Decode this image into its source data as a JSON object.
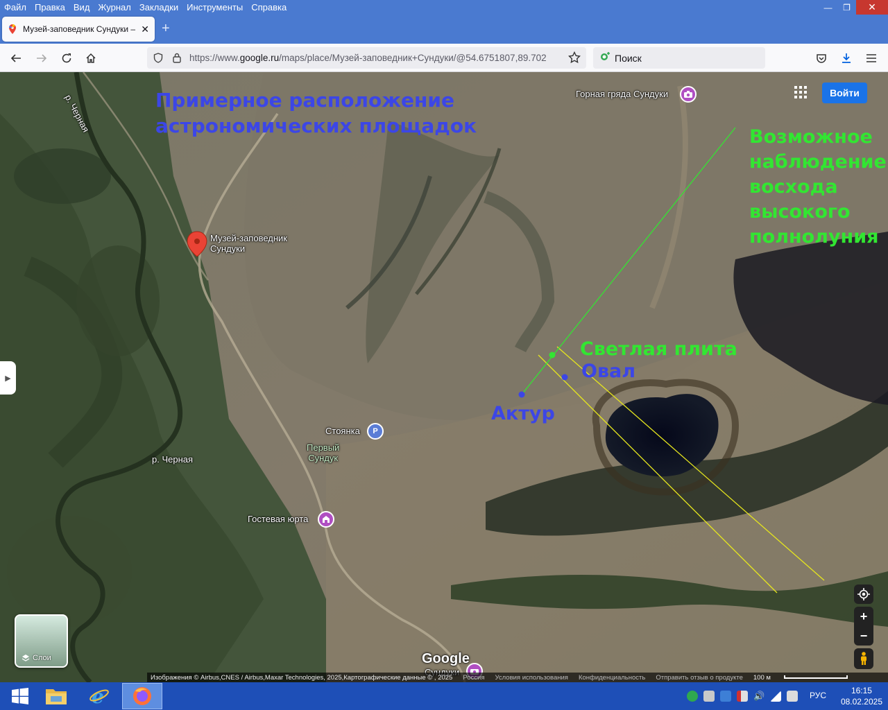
{
  "menu": [
    "Файл",
    "Правка",
    "Вид",
    "Журнал",
    "Закладки",
    "Инструменты",
    "Справка"
  ],
  "tab": {
    "title": "Музей-заповедник Сундуки – G",
    "close": "✕",
    "new_tab": "+"
  },
  "urlbar": {
    "prefix": "https://www.",
    "domain": "google.ru",
    "path": "/maps/place/Музей-заповедник+Сундуки/@54.6751807,89.702"
  },
  "searchbar": {
    "placeholder": "Поиск"
  },
  "map": {
    "title_line1": "Примерное расположение",
    "title_line2": "астрономических площадок",
    "moon_lines": [
      "Возможное",
      "наблюдение",
      "восхода",
      "высокого",
      "полнолуния"
    ],
    "plate_label": "Светлая плита",
    "oval_label": "Овал",
    "aktur_label": "Актур",
    "labels": {
      "ridge": "Горная гряда Сундуки",
      "museum_line1": "Музей-заповедник",
      "museum_line2": "Сундуки",
      "river_top": "р. Черная",
      "river_mid": "р. Черная",
      "parking": "Стоянка",
      "parking_icon": "P",
      "first_sunduk_line1": "Первый",
      "first_sunduk_line2": "Сундук",
      "guest_yurt": "Гостевая юрта",
      "bottom_poi": "Сундуки"
    },
    "signin": "Войти",
    "layers": "Слои",
    "google": "Google",
    "footer": {
      "imagery": "Изображения © Airbus,CNES / Airbus,Maxar Technologies, 2025,Картографические данные © , 2025",
      "country": "Россия",
      "terms": "Условия использования",
      "privacy": "Конфиденциальность",
      "feedback": "Отправить отзыв о продукте",
      "scale": "100 м"
    },
    "colors": {
      "blue_text": "#3c46e6",
      "green_text": "#32e632",
      "yellow_line": "#e6e61e",
      "green_line": "#32e632"
    }
  },
  "taskbar": {
    "lang": "РУС",
    "time": "16:15",
    "date": "08.02.2025"
  }
}
